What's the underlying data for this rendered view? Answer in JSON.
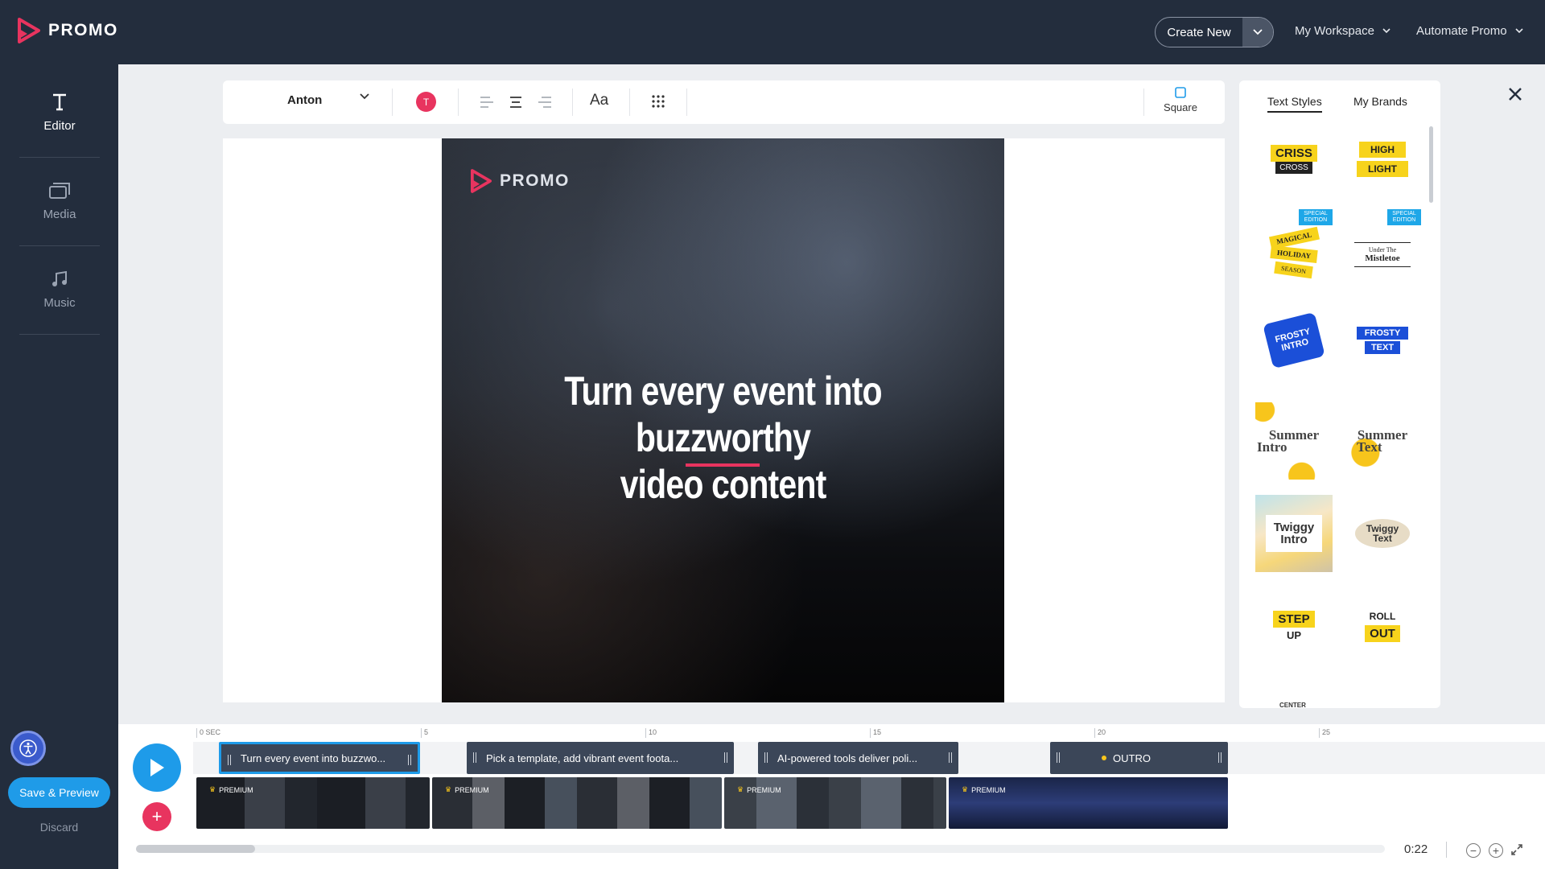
{
  "app": {
    "name": "PROMO"
  },
  "topbar": {
    "create_new": "Create New",
    "my_workspace": "My Workspace",
    "automate_promo": "Automate Promo"
  },
  "sidebar": {
    "items": [
      {
        "label": "Editor",
        "icon": "text-icon",
        "active": true
      },
      {
        "label": "Media",
        "icon": "media-icon",
        "active": false
      },
      {
        "label": "Music",
        "icon": "music-note-icon",
        "active": false
      }
    ],
    "save_preview": "Save & Preview",
    "discard": "Discard"
  },
  "toolbar": {
    "font": "Anton",
    "color_label": "T",
    "color": "#e8345f",
    "text_size_label": "Aa",
    "aspect": "Square"
  },
  "canvas": {
    "watermark": "PROMO",
    "headline_line1": "Turn every event into buzzworthy",
    "headline_line2": "video content",
    "accent": "#e8345f"
  },
  "styles_panel": {
    "tabs": [
      "Text Styles",
      "My Brands"
    ],
    "active_tab": "Text Styles",
    "tiles": [
      {
        "name": "criss-cross",
        "line1": "CRISS",
        "line2": "CROSS"
      },
      {
        "name": "high-light",
        "line1": "HIGH",
        "line2": "LIGHT"
      },
      {
        "name": "magical-holiday-season",
        "badge": "SPECIAL EDITION",
        "line1": "MAGICAL",
        "line2": "HOLIDAY",
        "line3": "SEASON"
      },
      {
        "name": "under-the-mistletoe",
        "badge": "SPECIAL EDITION",
        "line1": "Under The",
        "line2": "Mistletoe"
      },
      {
        "name": "frosty-intro",
        "line1": "FROSTY",
        "line2": "INTRO"
      },
      {
        "name": "frosty-text",
        "line1": "FROSTY",
        "line2": "TEXT"
      },
      {
        "name": "summer-intro",
        "line1": "Summer",
        "line2": "Intro"
      },
      {
        "name": "summer-text",
        "line1": "Summer",
        "line2": "Text"
      },
      {
        "name": "twiggy-intro",
        "line1": "Twiggy",
        "line2": "Intro"
      },
      {
        "name": "twiggy-text",
        "line1": "Twiggy",
        "line2": "Text"
      },
      {
        "name": "step-up",
        "line1": "STEP",
        "line2": "UP"
      },
      {
        "name": "roll-out",
        "line1": "ROLL",
        "line2": "OUT"
      }
    ],
    "partial_tile": "CENTER"
  },
  "timeline": {
    "ruler": [
      "0 SEC",
      "5",
      "10",
      "15",
      "20",
      "25"
    ],
    "text_clips": [
      {
        "label": "Turn every event into buzzwo...",
        "selected": true
      },
      {
        "label": "Pick a template, add vibrant event foota...",
        "selected": false
      },
      {
        "label": "AI-powered tools deliver poli...",
        "selected": false
      },
      {
        "label": "OUTRO",
        "selected": false
      }
    ],
    "video_clips": [
      {
        "badge": "PREMIUM"
      },
      {
        "badge": "PREMIUM"
      },
      {
        "badge": "PREMIUM"
      },
      {
        "badge": "PREMIUM"
      }
    ],
    "duration": "0:22"
  }
}
